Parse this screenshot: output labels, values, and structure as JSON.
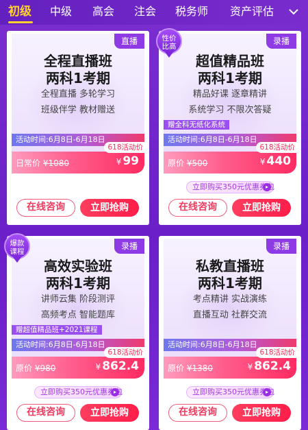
{
  "tabs": [
    {
      "label": "初级",
      "active": true
    },
    {
      "label": "中级",
      "active": false
    },
    {
      "label": "高会",
      "active": false
    },
    {
      "label": "注会",
      "active": false
    },
    {
      "label": "税务师",
      "active": false
    },
    {
      "label": "资产评估",
      "active": false
    }
  ],
  "colors": {
    "accent": "#ffd12b",
    "purple": "#8e3be6",
    "red": "#ff1d4a"
  },
  "cards": [
    {
      "type": "直播",
      "title1": "全程直播班",
      "title2": "两科1考期",
      "feat1": "全程直播  多轮学习",
      "feat2": "班级伴学  教材赠送",
      "time": "活动时间:6月8日-6月18日",
      "act": "618活动价",
      "orig_label": "日常价",
      "orig_price": "¥1080",
      "cur_price": "99",
      "consult": "在线咨询",
      "buy": "立即抢购"
    },
    {
      "type": "录播",
      "corner": "性价比高",
      "title1": "超值精品班",
      "title2": "两科1考期",
      "feat1": "精品好课    逐章精讲",
      "feat2": "系统学习    不限次答疑",
      "gift": "赠全科无纸化系统",
      "time": "活动时间:6月8日-6月18日",
      "act": "618活动价",
      "orig_label": "原价",
      "orig_price": "¥500",
      "cur_price": "440",
      "coupon": "立即购买350元优惠券包",
      "consult": "在线咨询",
      "buy": "立即抢购"
    },
    {
      "type": "录播",
      "corner": "爆款课程",
      "title1": "高效实验班",
      "title2": "两科1考期",
      "feat1": "讲师云集    阶段测评",
      "feat2": "高频考点    智能题库",
      "gift": "赠超值精品班+2021课程",
      "time": "活动时间:6月8日-6月18日",
      "act": "618活动价",
      "orig_label": "原价",
      "orig_price": "¥980",
      "cur_price": "862.4",
      "coupon": "立即购买350元优惠券包",
      "consult": "在线咨询",
      "buy": "立即抢购"
    },
    {
      "type": "录播",
      "title1": "私教直播班",
      "title2": "两科1考期",
      "feat1": "考点精讲    实战演练",
      "feat2": "直播互动    社群交流",
      "time": "活动时间:6月8日-6月18日",
      "act": "618活动价",
      "orig_label": "原价",
      "orig_price": "¥1380",
      "cur_price": "862.4",
      "coupon": "立即购买350元优惠券包",
      "consult": "在线咨询",
      "buy": "立即抢购"
    }
  ]
}
